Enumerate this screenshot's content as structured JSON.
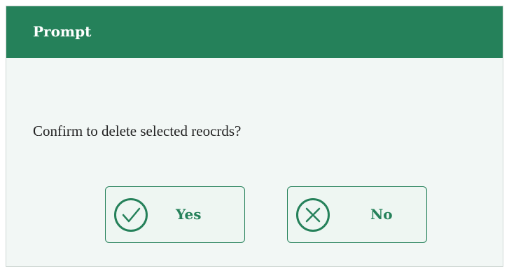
{
  "dialog": {
    "title": "Prompt",
    "message": "Confirm to delete selected reocrds?",
    "yes_label": "Yes",
    "no_label": "No",
    "yes_icon": "check-circle-icon",
    "no_icon": "x-circle-icon"
  },
  "colors": {
    "accent": "#25815a",
    "background": "#f2f7f5",
    "button_background": "#eef6f2",
    "text": "#222222"
  }
}
